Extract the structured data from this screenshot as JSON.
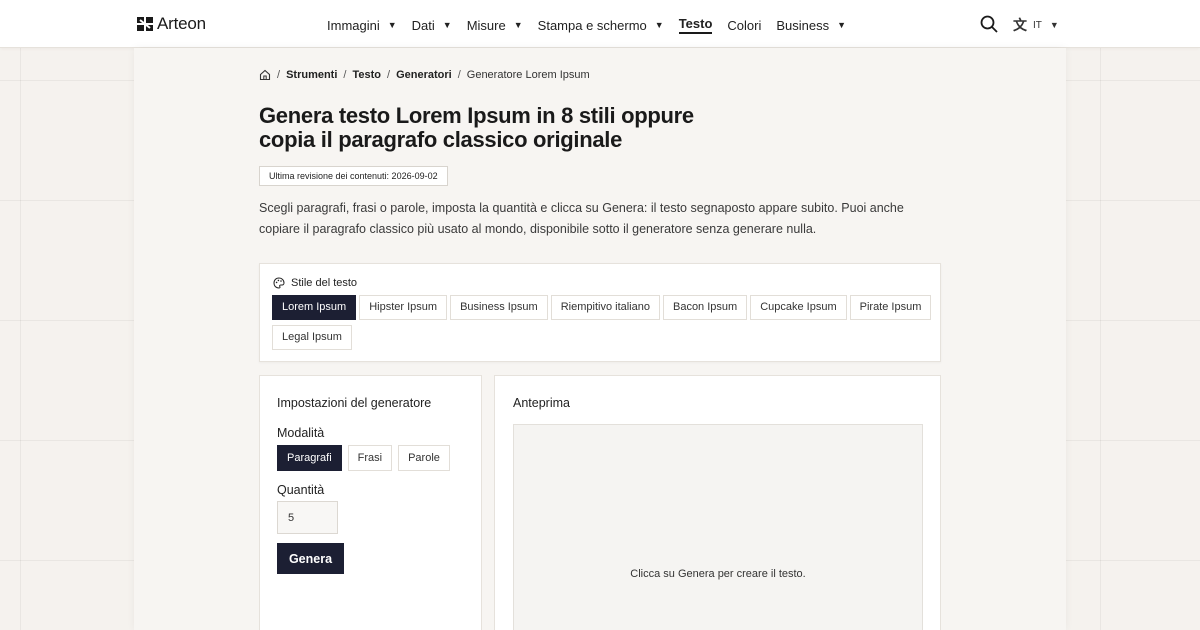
{
  "header": {
    "brand": "Arteon",
    "nav": [
      {
        "label": "Immagini",
        "active": false
      },
      {
        "label": "Dati",
        "active": false
      },
      {
        "label": "Misure",
        "active": false
      },
      {
        "label": "Stampa e schermo",
        "active": false
      },
      {
        "label": "Testo",
        "active": true
      },
      {
        "label": "Colori",
        "active": false
      },
      {
        "label": "Business",
        "active": false
      }
    ],
    "caret": "▼",
    "search_icon": "search-icon",
    "lang_icon": "translate-icon",
    "lang_label": "IT"
  },
  "breadcrumb": {
    "home_icon": "home-icon",
    "items": [
      "Strumenti",
      "Testo",
      "Generatori"
    ],
    "current": "Generatore Lorem Ipsum",
    "separator": "/"
  },
  "page": {
    "title": "Genera testo Lorem Ipsum in 8 stili oppure copia il paragrafo classico originale",
    "revision": "Ultima revisione dei contenuti: 2026-09-02",
    "intro": "Scegli paragrafi, frasi o parole, imposta la quantità e clicca su Genera: il testo segnaposto appare subito. Puoi anche copiare il paragrafo classico più usato al mondo, disponibile sotto il generatore senza generare nulla."
  },
  "style_card": {
    "title": "Stile del testo",
    "icon": "palette-icon",
    "styles": [
      {
        "label": "Lorem Ipsum",
        "active": true
      },
      {
        "label": "Hipster Ipsum",
        "active": false
      },
      {
        "label": "Business Ipsum",
        "active": false
      },
      {
        "label": "Riempitivo italiano",
        "active": false
      },
      {
        "label": "Bacon Ipsum",
        "active": false
      },
      {
        "label": "Cupcake Ipsum",
        "active": false
      },
      {
        "label": "Pirate Ipsum",
        "active": false
      },
      {
        "label": "Legal Ipsum",
        "active": false
      }
    ]
  },
  "settings": {
    "title": "Impostazioni del generatore",
    "mode_label": "Modalità",
    "modes": [
      {
        "label": "Paragrafi",
        "active": true
      },
      {
        "label": "Frasi",
        "active": false
      },
      {
        "label": "Parole",
        "active": false
      }
    ],
    "quantity_label": "Quantità",
    "quantity_value": "5",
    "generate_label": "Genera"
  },
  "preview": {
    "title": "Anteprima",
    "empty_message": "Clicca su Genera per creare il testo."
  },
  "colors": {
    "accent_dark": "#1c1f33",
    "page_bg": "#f5f2ee"
  }
}
